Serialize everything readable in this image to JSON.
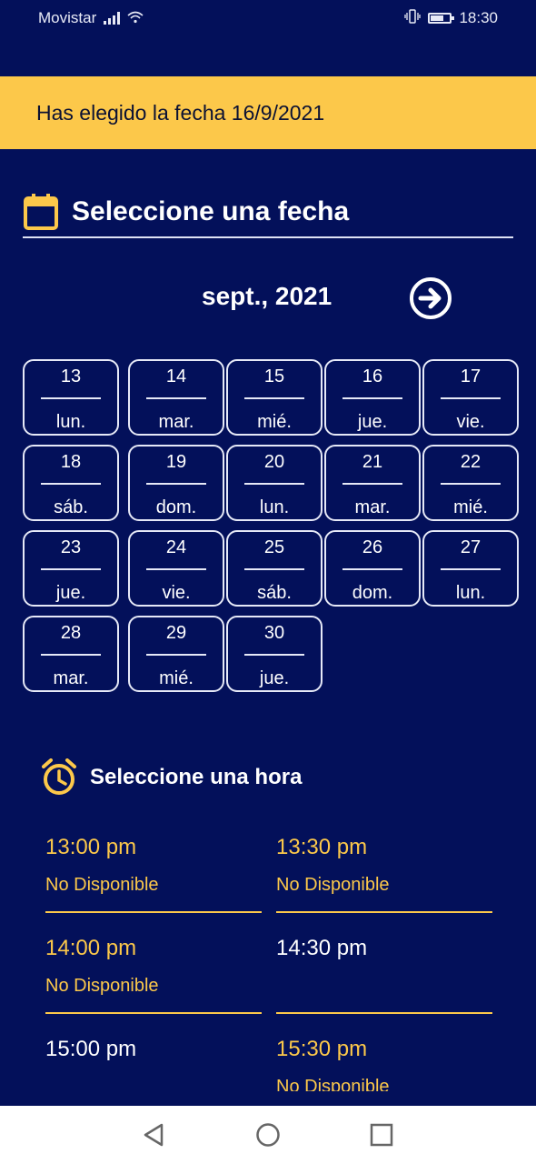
{
  "status": {
    "carrier": "Movistar",
    "time": "18:30"
  },
  "banner": {
    "text": "Has elegido la fecha 16/9/2021"
  },
  "date_section": {
    "title": "Seleccione una fecha",
    "month": "sept., 2021"
  },
  "days": [
    {
      "num": "13",
      "wd": "lun."
    },
    {
      "num": "14",
      "wd": "mar."
    },
    {
      "num": "15",
      "wd": "mié."
    },
    {
      "num": "16",
      "wd": "jue."
    },
    {
      "num": "17",
      "wd": "vie."
    },
    {
      "num": "18",
      "wd": "sáb."
    },
    {
      "num": "19",
      "wd": "dom."
    },
    {
      "num": "20",
      "wd": "lun."
    },
    {
      "num": "21",
      "wd": "mar."
    },
    {
      "num": "22",
      "wd": "mié."
    },
    {
      "num": "23",
      "wd": "jue."
    },
    {
      "num": "24",
      "wd": "vie."
    },
    {
      "num": "25",
      "wd": "sáb."
    },
    {
      "num": "26",
      "wd": "dom."
    },
    {
      "num": "27",
      "wd": "lun."
    },
    {
      "num": "28",
      "wd": "mar."
    },
    {
      "num": "29",
      "wd": "mié."
    },
    {
      "num": "30",
      "wd": "jue."
    }
  ],
  "time_section": {
    "title": "Seleccione una hora"
  },
  "slots": [
    {
      "time": "13:00 pm",
      "availability": "No Disponible"
    },
    {
      "time": "13:30 pm",
      "availability": "No Disponible"
    },
    {
      "time": "14:00 pm",
      "availability": "No Disponible"
    },
    {
      "time": "14:30 pm",
      "availability": ""
    },
    {
      "time": "15:00 pm",
      "availability": ""
    },
    {
      "time": "15:30 pm",
      "availability": "No Disponible"
    }
  ],
  "colors": {
    "background": "#03105a",
    "accent": "#fcc84a",
    "text": "#ffffff"
  }
}
